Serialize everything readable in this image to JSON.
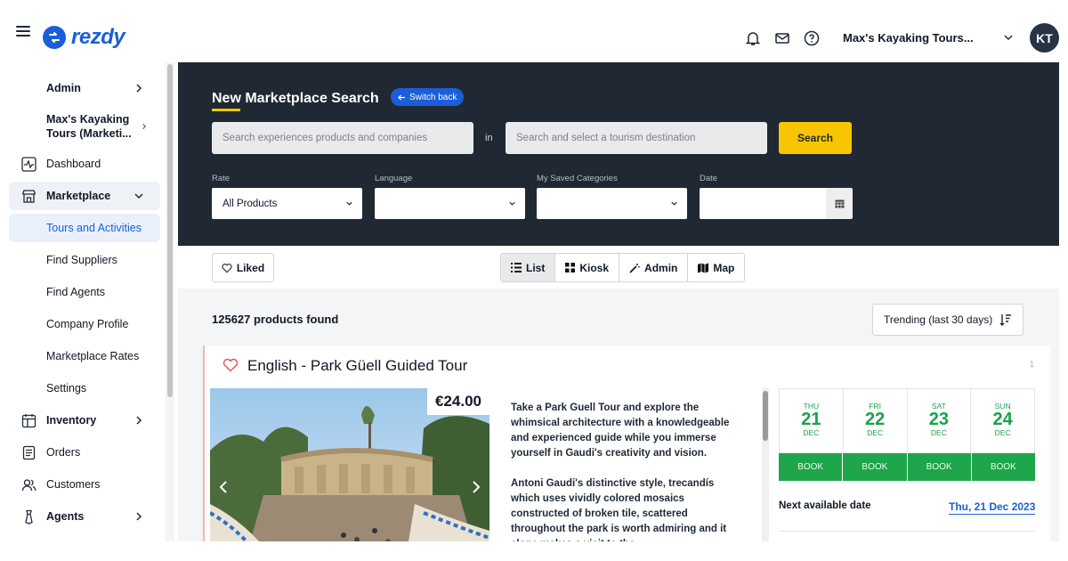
{
  "header": {
    "brand": "rezdy",
    "account_name": "Max's Kayaking Tours...",
    "avatar_initials": "KT"
  },
  "sidebar": {
    "items": [
      {
        "label": "Admin",
        "icon": "none",
        "has_chevron": true
      },
      {
        "label": "Max's Kayaking Tours (Marketi...",
        "icon": "none",
        "has_chevron": true
      },
      {
        "label": "Dashboard",
        "icon": "activity-icon"
      },
      {
        "label": "Marketplace",
        "icon": "storefront-icon",
        "expanded": true
      },
      {
        "label": "Tours and Activities",
        "active": true
      },
      {
        "label": "Find Suppliers"
      },
      {
        "label": "Find Agents"
      },
      {
        "label": "Company Profile"
      },
      {
        "label": "Marketplace Rates"
      },
      {
        "label": "Settings"
      },
      {
        "label": "Inventory",
        "icon": "calendar-icon",
        "has_chevron": true
      },
      {
        "label": "Orders",
        "icon": "document-icon"
      },
      {
        "label": "Customers",
        "icon": "users-icon"
      },
      {
        "label": "Agents",
        "icon": "agent-icon",
        "has_chevron": true
      }
    ]
  },
  "search": {
    "title": "New Marketplace Search",
    "switch_back": "Switch back",
    "query_placeholder": "Search experiences products and companies",
    "in_label": "in",
    "destination_placeholder": "Search and select a tourism destination",
    "search_button": "Search",
    "rate_label": "Rate",
    "rate_value": "All Products",
    "language_label": "Language",
    "language_value": "",
    "categories_label": "My Saved Categories",
    "categories_value": "",
    "date_label": "Date",
    "date_value": ""
  },
  "toolbar": {
    "liked": "Liked",
    "views": [
      "List",
      "Kiosk",
      "Admin",
      "Map"
    ],
    "active_view": "List"
  },
  "results": {
    "count_text": "125627 products found",
    "sort_value": "Trending (last 30 days)"
  },
  "product": {
    "index": "1",
    "title": "English - Park Güell Guided Tour",
    "price": "€24.00",
    "description_1": "Take a Park Guell Tour and explore the whimsical architecture with a knowledgeable and experienced guide while you immerse yourself in Gaudi's creativity and vision.",
    "description_2": "Antoni Gaudi's distinctive style, trecandís which uses vividly colored mosaics constructed of broken tile, scattered throughout the park is worth admiring and it alone makes a visit to the",
    "days": [
      {
        "dow": "THU",
        "num": "21",
        "mon": "DEC",
        "book": "BOOK"
      },
      {
        "dow": "FRI",
        "num": "22",
        "mon": "DEC",
        "book": "BOOK"
      },
      {
        "dow": "SAT",
        "num": "23",
        "mon": "DEC",
        "book": "BOOK"
      },
      {
        "dow": "SUN",
        "num": "24",
        "mon": "DEC",
        "book": "BOOK"
      }
    ],
    "next_available_label": "Next available date",
    "next_available_date": "Thu, 21 Dec 2023"
  },
  "colors": {
    "brand_blue": "#1a5fd8",
    "panel_dark": "#1f2833",
    "search_yellow": "#f7c600",
    "availability_green": "#1fa64a"
  }
}
